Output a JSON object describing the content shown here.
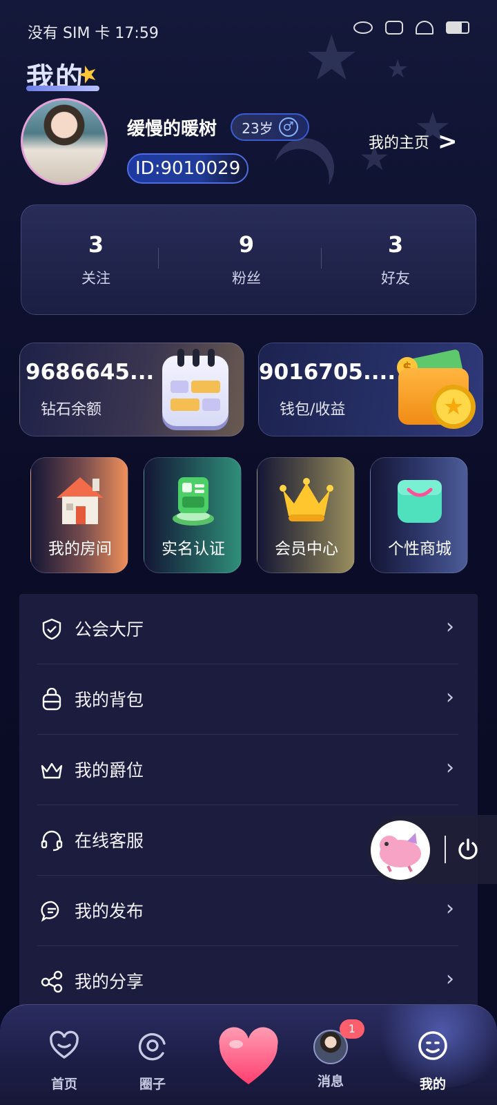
{
  "status_bar": {
    "text": "没有 SIM 卡 17:59"
  },
  "header": {
    "title": "我的",
    "username": "缓慢的暖树",
    "age": "23岁",
    "gender_symbol": "♂",
    "user_id": "ID:9010029",
    "homepage_link": "我的主页"
  },
  "stats": [
    {
      "value": "3",
      "label": "关注"
    },
    {
      "value": "9",
      "label": "粉丝"
    },
    {
      "value": "3",
      "label": "好友"
    }
  ],
  "balances": {
    "diamond": {
      "value": "9686645...",
      "label": "钻石余额"
    },
    "wallet": {
      "value": "9016705....",
      "label": "钱包/收益"
    }
  },
  "features": [
    {
      "label": "我的房间",
      "icon": "house-icon"
    },
    {
      "label": "实名认证",
      "icon": "id-card-icon"
    },
    {
      "label": "会员中心",
      "icon": "crown-icon"
    },
    {
      "label": "个性商城",
      "icon": "shopping-bag-icon"
    }
  ],
  "menu": [
    {
      "label": "公会大厅",
      "icon": "shield-icon"
    },
    {
      "label": "我的背包",
      "icon": "backpack-icon"
    },
    {
      "label": "我的爵位",
      "icon": "crown-outline-icon"
    },
    {
      "label": "在线客服",
      "icon": "headset-icon"
    },
    {
      "label": "我的发布",
      "icon": "chat-bubble-icon"
    },
    {
      "label": "我的分享",
      "icon": "share-icon"
    }
  ],
  "bottom_nav": [
    {
      "label": "首页",
      "icon": "heart-home-icon"
    },
    {
      "label": "圈子",
      "icon": "circle-at-icon"
    },
    {
      "label": "",
      "icon": "heart-button-icon"
    },
    {
      "label": "消息",
      "icon": "message-avatar-icon",
      "badge": "1"
    },
    {
      "label": "我的",
      "icon": "smile-face-icon",
      "active": true
    }
  ],
  "colors": {
    "background": "#0b0d28",
    "accent": "#4f6de0",
    "menu_panel": "#1b1c3e",
    "badge": "#ff5f6d"
  }
}
